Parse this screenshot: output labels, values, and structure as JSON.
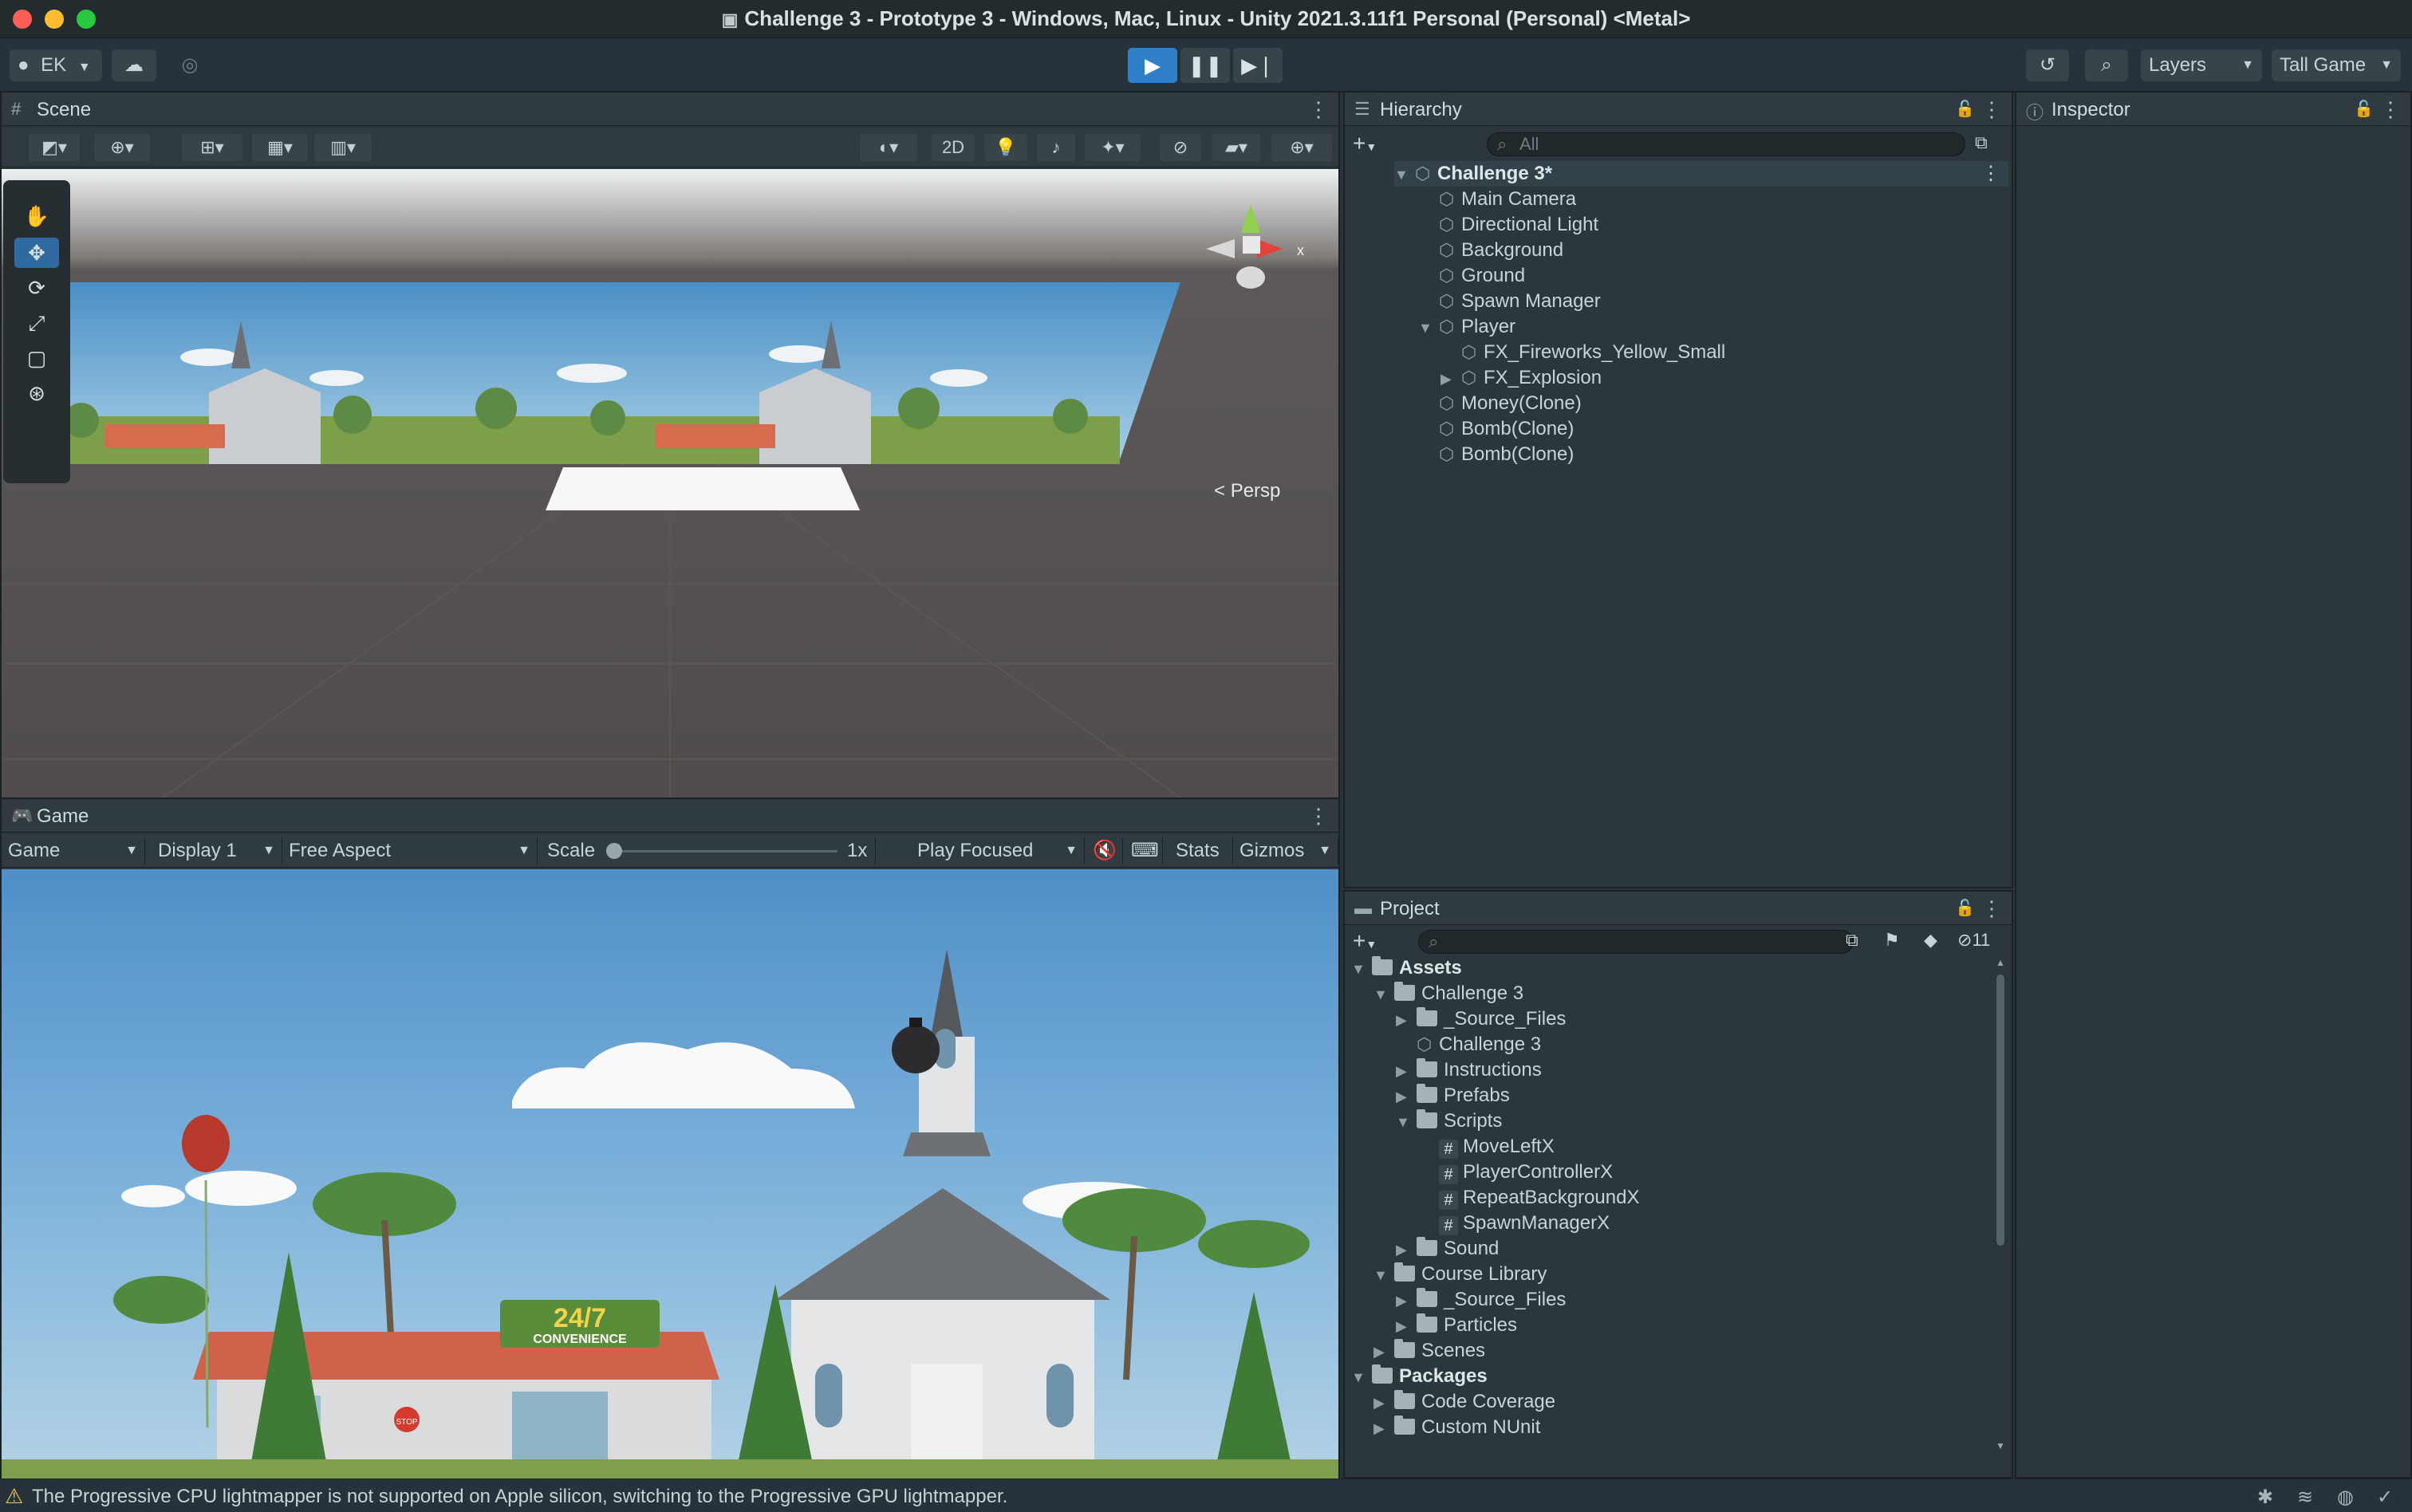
{
  "window": {
    "title": "Challenge 3 - Prototype 3 - Windows, Mac, Linux - Unity 2021.3.11f1 Personal (Personal) <Metal>"
  },
  "toolbar": {
    "account": "EK",
    "layers_label": "Layers",
    "layout_label": "Tall Game"
  },
  "scene": {
    "tab_label": "Scene",
    "mode_2d": "2D",
    "persp_label": "Persp",
    "gizmo_axis": "x"
  },
  "game": {
    "tab_label": "Game",
    "view_select": "Game",
    "display_select": "Display 1",
    "aspect_select": "Free Aspect",
    "scale_label": "Scale",
    "scale_value": "1x",
    "scale_fraction": 0,
    "play_mode_select": "Play Focused",
    "stats_label": "Stats",
    "gizmos_label": "Gizmos",
    "sign_big": "24/7",
    "sign_small": "CONVENIENCE",
    "stop_sign": "STOP"
  },
  "hierarchy": {
    "tab_label": "Hierarchy",
    "search_placeholder": "All",
    "items": [
      {
        "label": "Challenge 3*",
        "depth": 0,
        "expanded": true,
        "root": true
      },
      {
        "label": "Main Camera",
        "depth": 1
      },
      {
        "label": "Directional Light",
        "depth": 1
      },
      {
        "label": "Background",
        "depth": 1
      },
      {
        "label": "Ground",
        "depth": 1
      },
      {
        "label": "Spawn Manager",
        "depth": 1
      },
      {
        "label": "Player",
        "depth": 1,
        "expanded": true
      },
      {
        "label": "FX_Fireworks_Yellow_Small",
        "depth": 2
      },
      {
        "label": "FX_Explosion",
        "depth": 2,
        "collapsed": true
      },
      {
        "label": "Money(Clone)",
        "depth": 1
      },
      {
        "label": "Bomb(Clone)",
        "depth": 1
      },
      {
        "label": "Bomb(Clone)",
        "depth": 1
      }
    ]
  },
  "inspector": {
    "tab_label": "Inspector"
  },
  "project": {
    "tab_label": "Project",
    "hidden_count": "11",
    "items": [
      {
        "label": "Assets",
        "depth": 0,
        "type": "folder",
        "expanded": true,
        "bold": true
      },
      {
        "label": "Challenge 3",
        "depth": 1,
        "type": "folder",
        "expanded": true
      },
      {
        "label": "_Source_Files",
        "depth": 2,
        "type": "folder",
        "collapsed": true
      },
      {
        "label": "Challenge 3",
        "depth": 2,
        "type": "scene"
      },
      {
        "label": "Instructions",
        "depth": 2,
        "type": "folder",
        "collapsed": true
      },
      {
        "label": "Prefabs",
        "depth": 2,
        "type": "folder",
        "collapsed": true
      },
      {
        "label": "Scripts",
        "depth": 2,
        "type": "folder",
        "expanded": true
      },
      {
        "label": "MoveLeftX",
        "depth": 3,
        "type": "script"
      },
      {
        "label": "PlayerControllerX",
        "depth": 3,
        "type": "script"
      },
      {
        "label": "RepeatBackgroundX",
        "depth": 3,
        "type": "script"
      },
      {
        "label": "SpawnManagerX",
        "depth": 3,
        "type": "script"
      },
      {
        "label": "Sound",
        "depth": 2,
        "type": "folder",
        "collapsed": true
      },
      {
        "label": "Course Library",
        "depth": 1,
        "type": "folder",
        "expanded": true
      },
      {
        "label": "_Source_Files",
        "depth": 2,
        "type": "folder",
        "collapsed": true
      },
      {
        "label": "Particles",
        "depth": 2,
        "type": "folder",
        "collapsed": true
      },
      {
        "label": "Scenes",
        "depth": 1,
        "type": "folder",
        "collapsed": true
      },
      {
        "label": "Packages",
        "depth": 0,
        "type": "folder",
        "expanded": true,
        "bold": true
      },
      {
        "label": "Code Coverage",
        "depth": 1,
        "type": "folder",
        "collapsed": true
      },
      {
        "label": "Custom NUnit",
        "depth": 1,
        "type": "folder",
        "collapsed": true
      }
    ]
  },
  "status": {
    "message": "The Progressive CPU lightmapper is not supported on Apple silicon, switching to the Progressive GPU lightmapper."
  },
  "colors": {
    "play_active": "#2f80c9",
    "panel_bg": "#2c373c",
    "warning": "#e5c04a"
  }
}
